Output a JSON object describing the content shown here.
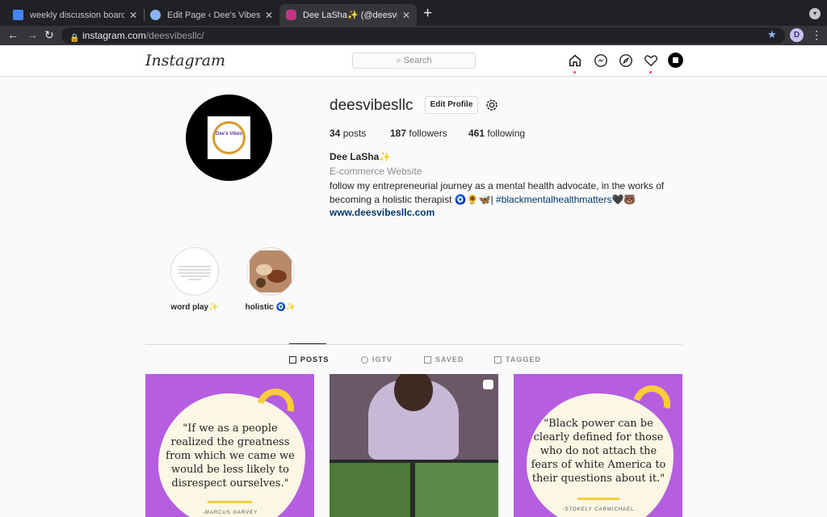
{
  "browser": {
    "tabs": [
      {
        "title": "weekly discussion board- roug",
        "favicon_color": "#4285f4"
      },
      {
        "title": "Edit Page ‹ Dee's Vibes — Wor",
        "favicon_color": "#8ab4f8"
      },
      {
        "title": "Dee LaSha✨ (@deesvibesllc)",
        "favicon_color": "#c13584"
      }
    ],
    "url_host": "instagram.com",
    "url_path": "/deesvibesllc/",
    "profile_initial": "D"
  },
  "ig": {
    "logo": "Instagram",
    "search_placeholder": "Search",
    "profile": {
      "username": "deesvibesllc",
      "edit_label": "Edit Profile",
      "posts_count": "34",
      "posts_label": "posts",
      "followers_count": "187",
      "followers_label": "followers",
      "following_count": "461",
      "following_label": "following",
      "full_name": "Dee LaSha✨",
      "category": "E-commerce Website",
      "bio_line1": "follow my entrepreneurial journey as a mental health advocate, in the works of",
      "bio_line2": "becoming a holistic therapist 🧿🌻🦋| ",
      "bio_hashtag": "#blackmentalhealthmatters",
      "bio_end": "🖤🐻",
      "website": "www.deesvibesllc.com",
      "pic_label": "Dee's Vibes"
    },
    "highlights": [
      {
        "label": "word play✨"
      },
      {
        "label": "holistic 🧿✨"
      }
    ],
    "tabs": [
      {
        "label": "POSTS"
      },
      {
        "label": "IGTV"
      },
      {
        "label": "SAVED"
      },
      {
        "label": "TAGGED"
      }
    ],
    "posts": [
      {
        "quote": "\"If we as a people realized the greatness from which we came we would be less likely to disrespect ourselves.\"",
        "author": "-MARCUS GARVEY"
      },
      {
        "kind": "video"
      },
      {
        "quote": "\"Black power can be clearly defined for those who do not attach the fears of white America to their questions about it.\"",
        "author": "-STOKELY CARMICHAEL"
      }
    ]
  }
}
